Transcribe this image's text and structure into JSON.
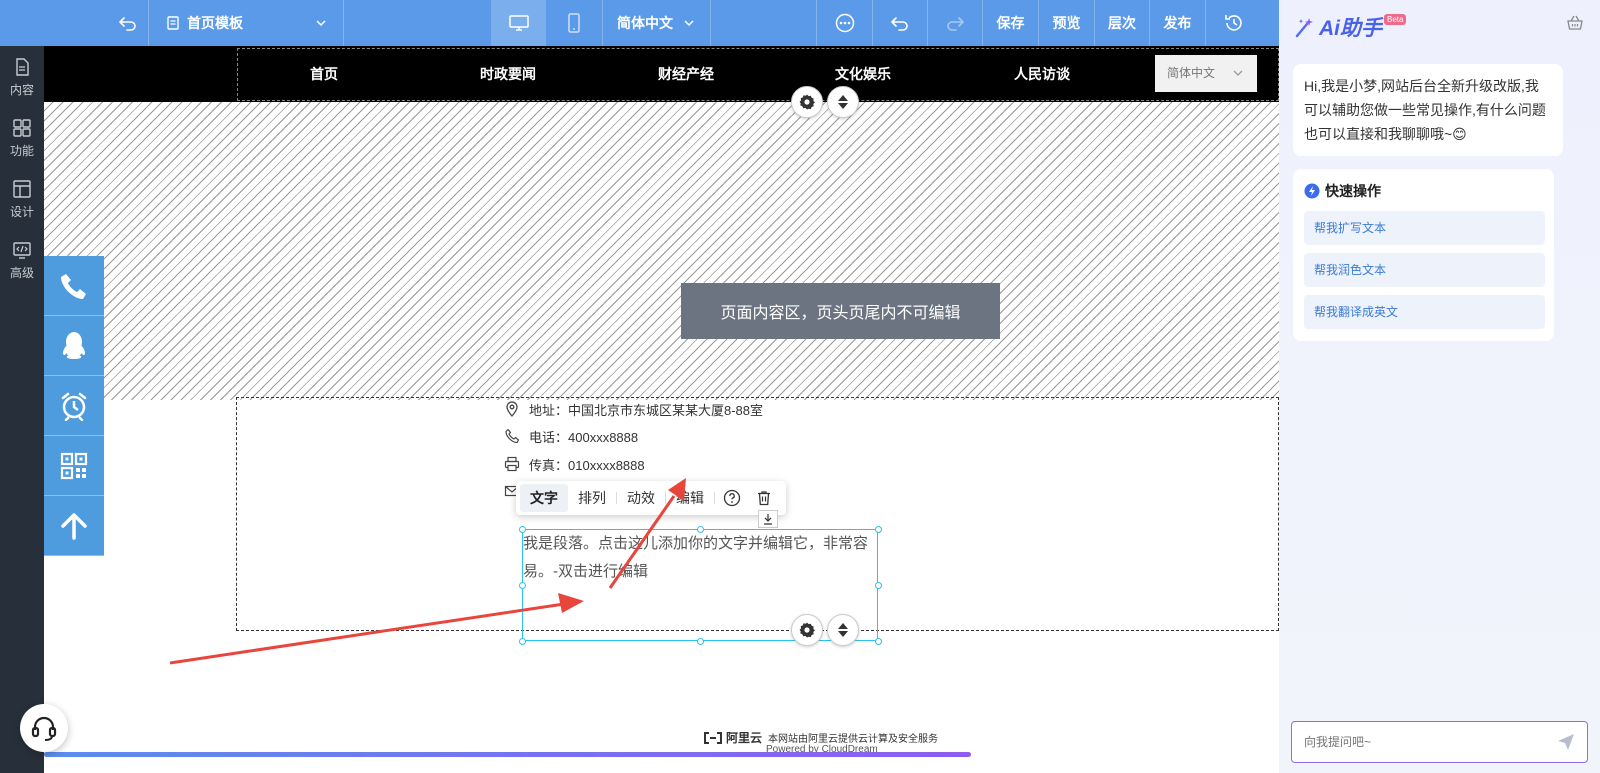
{
  "topbar": {
    "template_label": "首页模板",
    "language": "简体中文",
    "save": "保存",
    "preview": "预览",
    "layers": "层次",
    "publish": "发布"
  },
  "leftnav": {
    "items": [
      {
        "label": "内容",
        "icon": "document-icon"
      },
      {
        "label": "功能",
        "icon": "grid-icon"
      },
      {
        "label": "设计",
        "icon": "layout-icon"
      },
      {
        "label": "高级",
        "icon": "code-icon"
      }
    ]
  },
  "site": {
    "nav": [
      "首页",
      "时政要闻",
      "财经产经",
      "文化娱乐",
      "人民访谈"
    ],
    "language_select": "简体中文",
    "notice": "页面内容区，页头页尾内不可编辑",
    "contact": {
      "address": "地址：中国北京市东城区某某大厦8-88室",
      "phone": "电话：400xxx8888",
      "fax": "传真：010xxxx8888"
    },
    "paragraph": "我是段落。点击这儿添加你的文字并编辑它，非常容易。-双击进行编辑",
    "footer": {
      "cloud_logo": "阿里云",
      "cloud_text": "本网站由阿里云提供云计算及安全服务",
      "powered_by": "Powered by CloudDream"
    }
  },
  "text_toolbar": {
    "text": "文字",
    "arrange": "排列",
    "animation": "动效",
    "edit": "编辑"
  },
  "ai_panel": {
    "title": "Ai助手",
    "badge": "Beta",
    "greeting": "Hi,我是小梦,网站后台全新升级改版,我可以辅助您做一些常见操作,有什么问题也可以直接和我聊聊哦~😊",
    "quick_title": "快速操作",
    "quick_actions": [
      "帮我扩写文本",
      "帮我润色文本",
      "帮我翻译成英文"
    ],
    "input_placeholder": "向我提问吧~"
  },
  "colors": {
    "topbar": "#5b9ae8",
    "leftnav": "#27303a",
    "side_tools": "#4e9bdd",
    "selection": "#29c4f0",
    "arrow": "#e8453c",
    "ai_accent": "#7b5cf0"
  }
}
